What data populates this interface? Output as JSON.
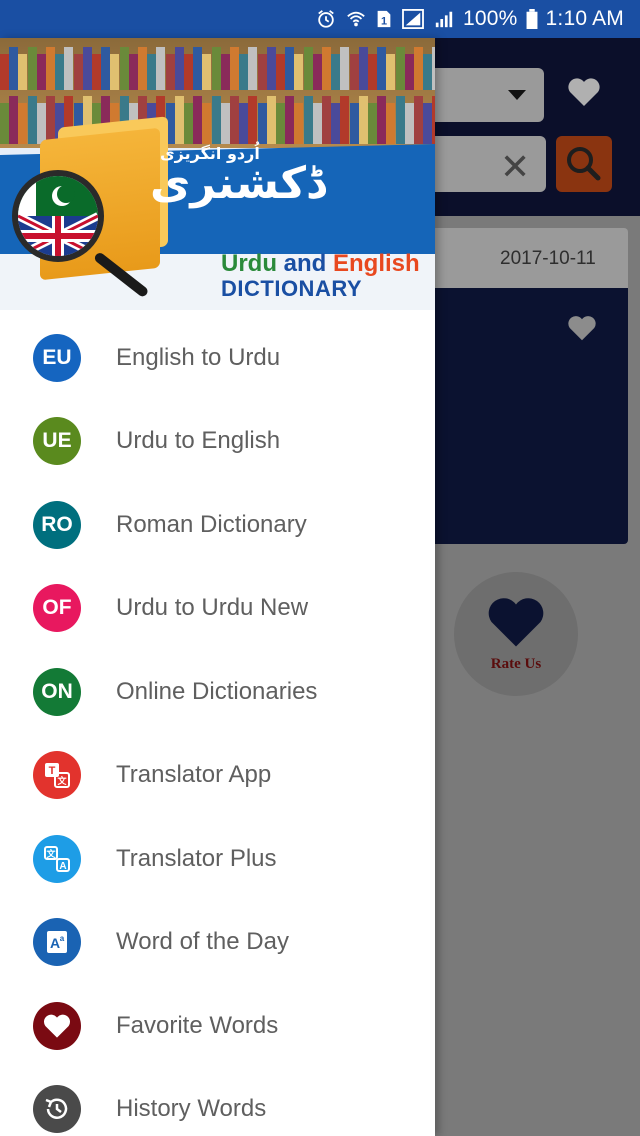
{
  "status_bar": {
    "battery_percent": "100%",
    "time": "1:10 AM",
    "icons": [
      "alarm-icon",
      "wifi-icon",
      "sim-1-icon",
      "signal-icon",
      "signal-bars-icon",
      "battery-icon"
    ]
  },
  "background": {
    "card_date": "2017-10-11",
    "rate_us_label": "Rate Us",
    "colors": {
      "header": "#0b0f2a",
      "search_button": "#8a3410"
    }
  },
  "drawer": {
    "banner": {
      "urdu_title": "ڈکشنری",
      "urdu_subtitle": "اُردو انگریزی",
      "title_word1": "Urdu",
      "title_word2": "and",
      "title_word3": "English",
      "title_line2": "DICTIONARY"
    },
    "items": [
      {
        "icon_text": "EU",
        "label": "English to Urdu",
        "color": "#1565c0",
        "icon": "eu-badge-icon"
      },
      {
        "icon_text": "UE",
        "label": "Urdu to English",
        "color": "#5a8a1e",
        "icon": "ue-badge-icon"
      },
      {
        "icon_text": "RO",
        "label": "Roman Dictionary",
        "color": "#006f7e",
        "icon": "ro-badge-icon"
      },
      {
        "icon_text": "OF",
        "label": "Urdu to Urdu New",
        "color": "#e8185f",
        "icon": "of-badge-icon"
      },
      {
        "icon_text": "ON",
        "label": "Online Dictionaries",
        "color": "#137a36",
        "icon": "on-badge-icon"
      },
      {
        "icon_text": "",
        "label": "Translator App",
        "color": "#e2332d",
        "icon": "translate-icon"
      },
      {
        "icon_text": "",
        "label": "Translator Plus",
        "color": "#1e9de6",
        "icon": "translate-plus-icon"
      },
      {
        "icon_text": "",
        "label": "Word of the Day",
        "color": "#1a63b3",
        "icon": "word-of-day-icon"
      },
      {
        "icon_text": "",
        "label": "Favorite Words",
        "color": "#7a0a12",
        "icon": "heart-icon"
      },
      {
        "icon_text": "",
        "label": "History Words",
        "color": "#4a4a4a",
        "icon": "history-icon"
      }
    ]
  }
}
